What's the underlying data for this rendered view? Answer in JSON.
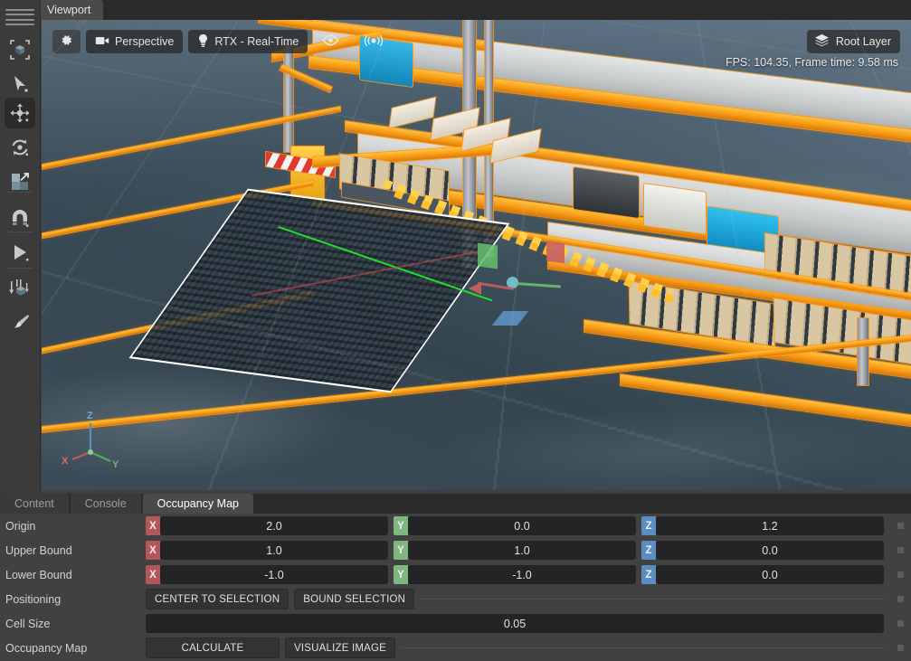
{
  "window": {
    "viewport_tab": "Viewport"
  },
  "toolrail": {
    "items": [
      {
        "name": "menu-hamburger",
        "label": "Menu"
      },
      {
        "name": "select-cube-tool",
        "label": "Selection Mode"
      },
      {
        "name": "pointer-tool",
        "label": "Select"
      },
      {
        "name": "move-tool",
        "label": "Move",
        "active": true
      },
      {
        "name": "rotate-tool",
        "label": "Rotate"
      },
      {
        "name": "scale-tool",
        "label": "Scale"
      },
      {
        "name": "snap-tool",
        "label": "Snap"
      },
      {
        "name": "play-tool",
        "label": "Play"
      },
      {
        "name": "drop-tool",
        "label": "Physics Drop"
      },
      {
        "name": "paint-tool",
        "label": "Paint"
      }
    ]
  },
  "viewport": {
    "settings_icon": "gear-icon",
    "camera": "Perspective",
    "renderer": "RTX - Real-Time",
    "visibility_icon": "eye-icon",
    "audio_icon": "audio-icon",
    "layer": "Root Layer",
    "layer_icon": "layers-icon",
    "stats": "FPS: 104.35, Frame time: 9.58 ms",
    "axis_labels": {
      "x": "X",
      "y": "Y",
      "z": "Z"
    }
  },
  "dock": {
    "tabs": [
      {
        "label": "Content",
        "active": false
      },
      {
        "label": "Console",
        "active": false
      },
      {
        "label": "Occupancy Map",
        "active": true
      }
    ],
    "rows": {
      "origin": {
        "label": "Origin",
        "x": "2.0",
        "y": "0.0",
        "z": "1.2",
        "x_tag": "X",
        "y_tag": "Y",
        "z_tag": "Z"
      },
      "upper_bound": {
        "label": "Upper Bound",
        "x": "1.0",
        "y": "1.0",
        "z": "0.0",
        "x_tag": "X",
        "y_tag": "Y",
        "z_tag": "Z"
      },
      "lower_bound": {
        "label": "Lower Bound",
        "x": "-1.0",
        "y": "-1.0",
        "z": "0.0",
        "x_tag": "X",
        "y_tag": "Y",
        "z_tag": "Z"
      },
      "positioning": {
        "label": "Positioning",
        "center_to_selection": "CENTER TO SELECTION",
        "bound_selection": "BOUND SELECTION"
      },
      "cell_size": {
        "label": "Cell Size",
        "value": "0.05"
      },
      "occupancy_map": {
        "label": "Occupancy Map",
        "calculate": "CALCULATE",
        "visualize_image": "VISUALIZE IMAGE"
      }
    }
  },
  "colors": {
    "axis_x": "#b4565a",
    "axis_y": "#7fb87f",
    "axis_z": "#5a8ec2",
    "selection_outline": "#ff9614",
    "panel_bg": "#414141",
    "field_bg": "#242427"
  }
}
